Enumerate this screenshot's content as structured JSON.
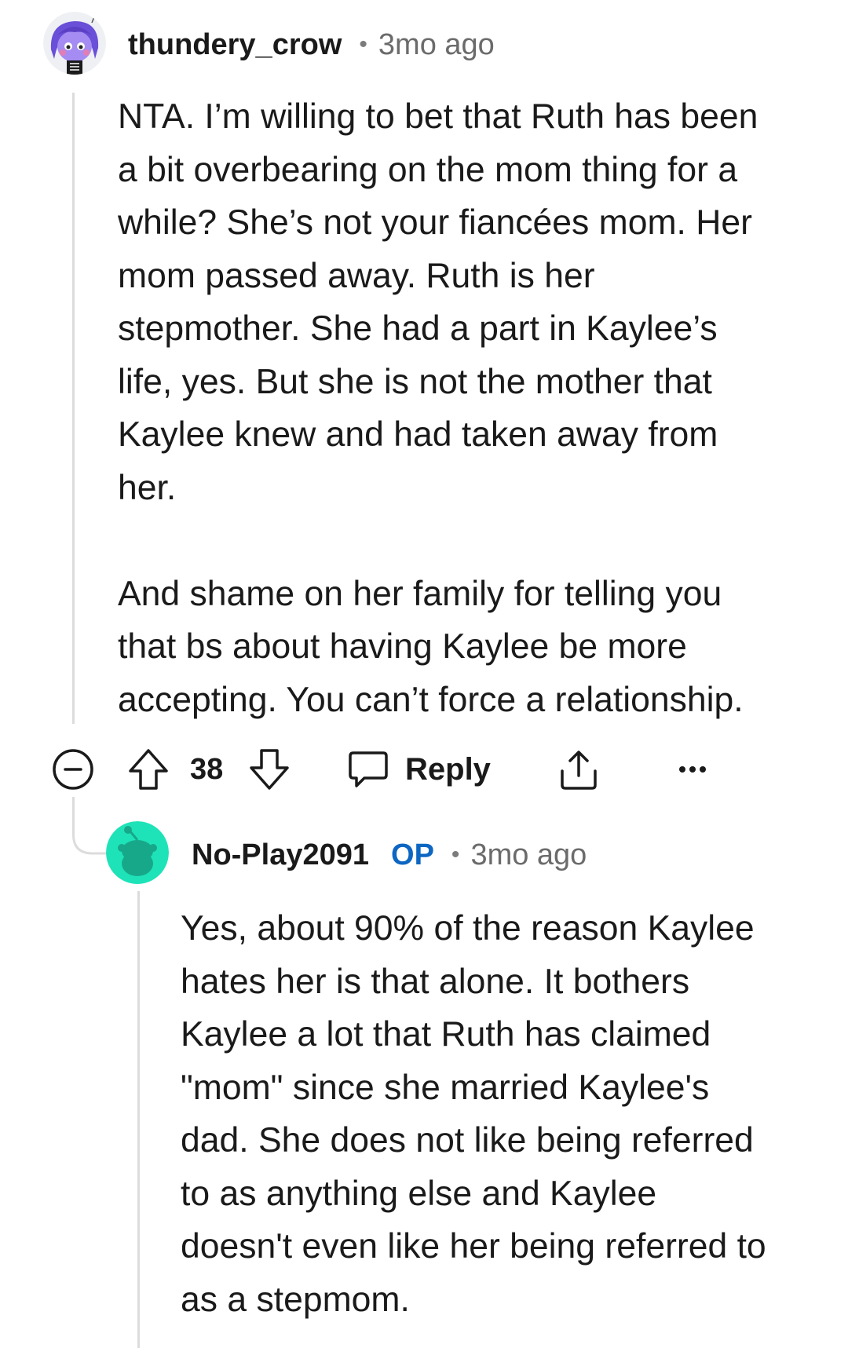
{
  "comment": {
    "username": "thundery_crow",
    "separator": "•",
    "time": "3mo ago",
    "avatar_icon": "snoo-avatar-purple-hair-icon",
    "paragraphs": [
      [
        "NTA. I’m willing to bet that Ruth has been",
        "a bit overbearing on the mom thing for a",
        "while? She’s not your fiancées mom. Her",
        "mom passed away. Ruth is her",
        "stepmother. She had a part in Kaylee’s",
        "life, yes. But she is not the mother that",
        "Kaylee knew and had taken away from",
        "her."
      ],
      [
        "And shame on her family for telling you",
        "that bs about having Kaylee be more",
        "accepting. You can’t force a relationship."
      ]
    ],
    "actions": {
      "collapse_icon": "collapse-minus-icon",
      "upvote_icon": "upvote-arrow-icon",
      "vote_count": "38",
      "downvote_icon": "downvote-arrow-icon",
      "reply_icon": "speech-bubble-icon",
      "reply_label": "Reply",
      "share_icon": "share-upload-icon",
      "more_icon": "more-options-icon",
      "more_label": "•••"
    }
  },
  "reply": {
    "username": "No-Play2091",
    "op_badge": "OP",
    "separator": "•",
    "time": "3mo ago",
    "avatar_icon": "snoo-avatar-teal-icon",
    "lines": [
      "Yes, about 90% of the reason Kaylee",
      "hates her is that alone. It bothers",
      "Kaylee a lot that Ruth has claimed",
      "\"mom\" since she married Kaylee's",
      "dad. She does not like being referred",
      "to as anything else and Kaylee",
      "doesn't even like her being referred to",
      "as a stepmom."
    ]
  },
  "colors": {
    "text": "#1a1a1b",
    "meta": "#6b6b6b",
    "op": "#0d66c2",
    "thread_line": "#dcdcdc",
    "teal_avatar": "#1ee3b8"
  }
}
